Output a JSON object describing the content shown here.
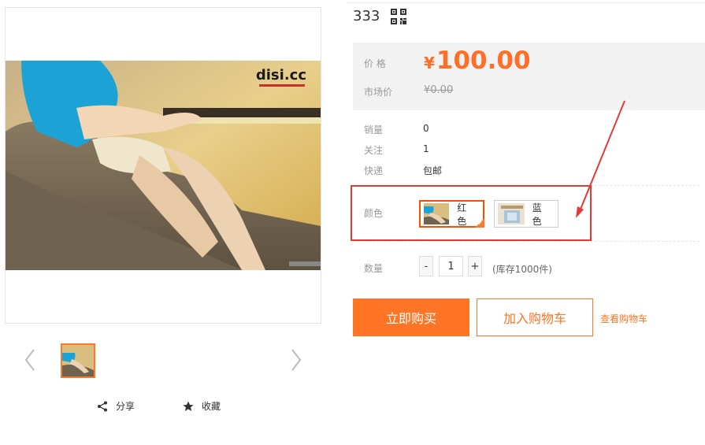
{
  "product": {
    "title": "333",
    "watermark": "disi.cc"
  },
  "price": {
    "label": "价 格",
    "currency": "¥",
    "value": "100.00",
    "market_label": "市场价",
    "market_value": "¥0.00"
  },
  "meta": [
    {
      "key": "销量",
      "value": "0"
    },
    {
      "key": "关注",
      "value": "1"
    },
    {
      "key": "快递",
      "value": "包邮"
    }
  ],
  "color": {
    "label": "颜色",
    "options": [
      {
        "name": "红色",
        "selected": true
      },
      {
        "name": "蓝色",
        "selected": false
      }
    ]
  },
  "quantity": {
    "label": "数量",
    "minus": "-",
    "value": "1",
    "plus": "+",
    "stock": "(库存1000件)"
  },
  "buttons": {
    "buy_now": "立即购买",
    "add_to_cart": "加入购物车",
    "view_cart": "查看购物车"
  },
  "actions": {
    "share": "分享",
    "favorite": "收藏"
  },
  "icons": {
    "qr": "qr-code-icon",
    "share": "share-icon",
    "favorite": "star-icon",
    "prev": "chevron-left-icon",
    "next": "chevron-right-icon"
  },
  "colors": {
    "accent": "#ff7425",
    "price": "#ff6f28",
    "annotation": "#e53935",
    "price_bg": "#f2f2f2"
  }
}
